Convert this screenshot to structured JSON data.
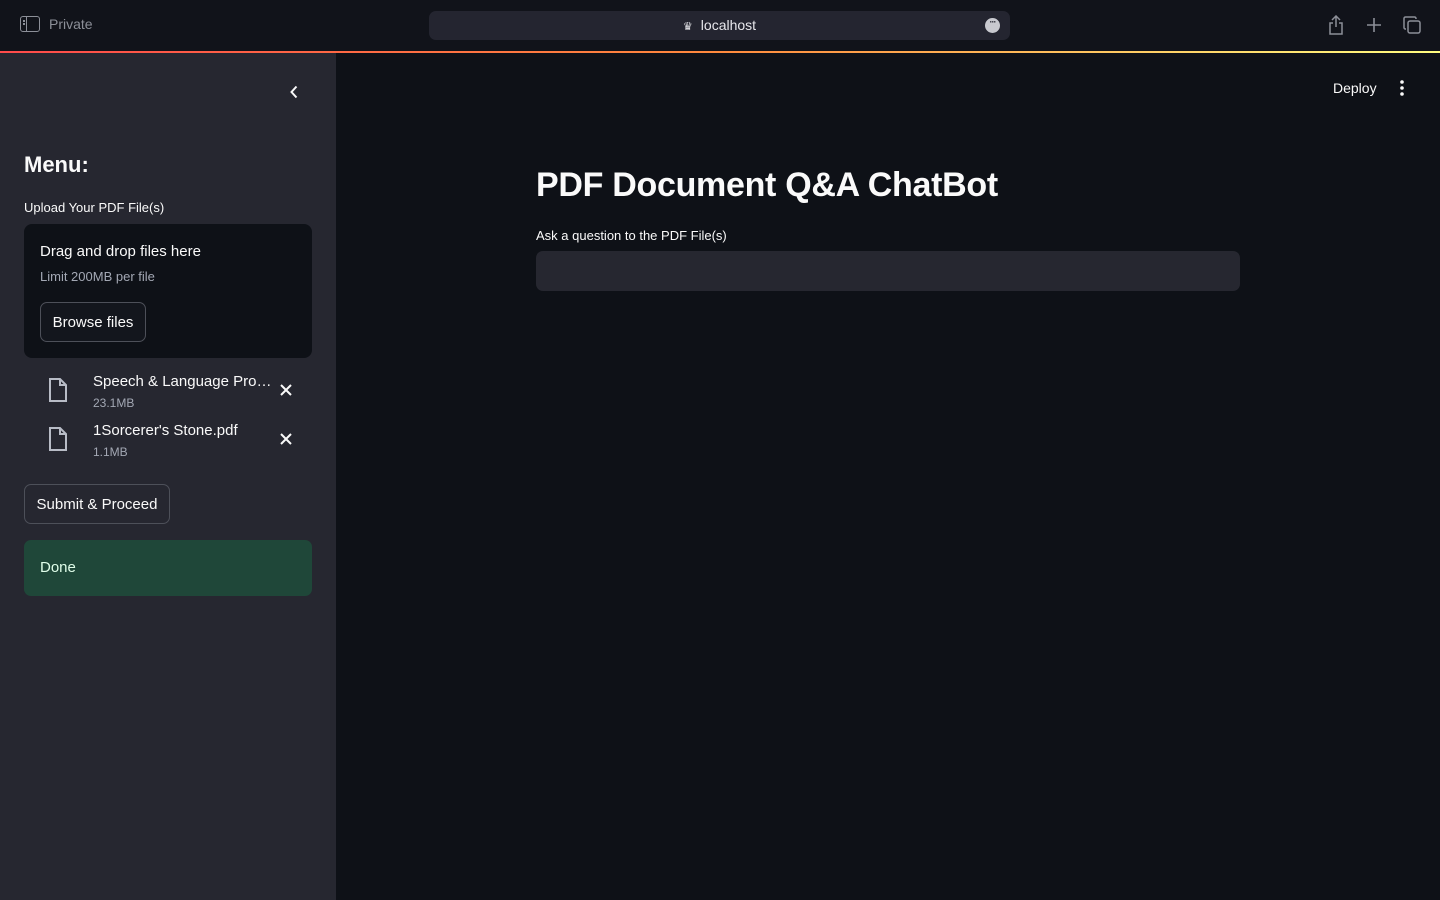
{
  "browser": {
    "private_label": "Private",
    "url": "localhost"
  },
  "sidebar": {
    "menu_title": "Menu:",
    "upload_label": "Upload Your PDF File(s)",
    "dropzone": {
      "title": "Drag and drop files here",
      "limit": "Limit 200MB per file",
      "browse_label": "Browse files"
    },
    "files": [
      {
        "name": "Speech & Language Proc...",
        "size": "23.1MB"
      },
      {
        "name": "1Sorcerer's Stone.pdf",
        "size": "1.1MB"
      }
    ],
    "submit_label": "Submit & Proceed",
    "status_text": "Done"
  },
  "main": {
    "deploy_label": "Deploy",
    "title": "PDF Document Q&A ChatBot",
    "question_label": "Ask a question to the PDF File(s)",
    "question_value": ""
  },
  "colors": {
    "app_background": "#0e1117",
    "sidebar_background": "#262730",
    "success_background": "#1f4739"
  }
}
